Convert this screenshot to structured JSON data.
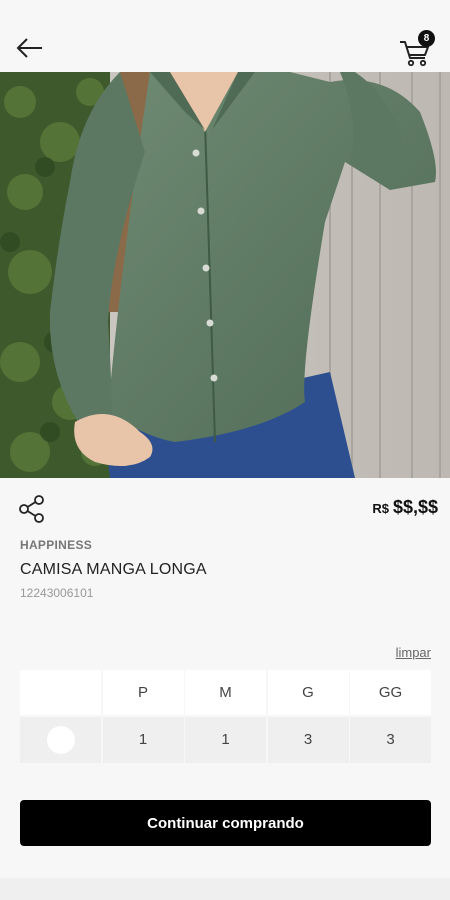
{
  "header": {
    "back_icon": "arrow-left-icon",
    "cart_icon": "shopping-cart-icon",
    "cart_count": "8"
  },
  "product": {
    "share_icon": "share-icon",
    "currency": "R$",
    "price": "$$,$$",
    "brand": "HAPPINESS",
    "name": "CAMISA MANGA LONGA",
    "sku": "12243006101"
  },
  "sizes": {
    "clear_label": "limpar",
    "headers": [
      "P",
      "M",
      "G",
      "GG"
    ],
    "color_swatch": "#ffffff",
    "quantities": [
      "1",
      "1",
      "3",
      "3"
    ]
  },
  "actions": {
    "continue_label": "Continuar comprando"
  }
}
